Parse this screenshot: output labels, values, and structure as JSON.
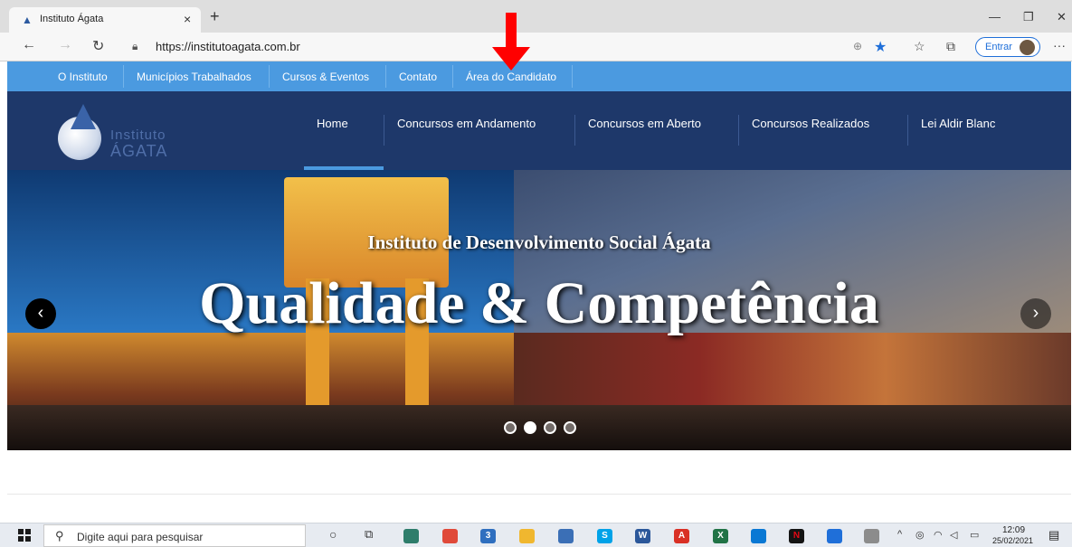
{
  "browser": {
    "tab_title": "Instituto Ágata",
    "tab_close": "×",
    "new_tab": "+",
    "url": "https://institutoagata.com.br",
    "entrar_label": "Entrar",
    "window_controls": [
      "—",
      "❐",
      "✕"
    ],
    "icons": [
      "back-icon",
      "forward-icon",
      "refresh-icon",
      "lock-icon",
      "zoom-icon",
      "favorite-star-icon",
      "favorites-list-icon",
      "collections-icon",
      "more-icon"
    ]
  },
  "site": {
    "top_nav": [
      "O Instituto",
      "Municípios Trabalhados",
      "Cursos & Eventos",
      "Contato",
      "Área do Candidato"
    ],
    "logo": {
      "line1": "Instituto",
      "line2": "ÁGATA"
    },
    "main_nav": [
      "Home",
      "Concursos em Andamento",
      "Concursos em Aberto",
      "Concursos Realizados",
      "Lei Aldir Blanc"
    ],
    "hero": {
      "subtitle": "Instituto de Desenvolvimento Social Ágata",
      "title": "Qualidade & Competência",
      "prev": "‹",
      "next": "›"
    }
  },
  "taskbar": {
    "search_placeholder": "Digite aqui para pesquisar",
    "time": "12:09",
    "date": "25/02/2021",
    "mail_badge": "3"
  },
  "colors": {
    "top_nav_bg": "#4b9ae0",
    "main_nav_bg": "#1e386a",
    "annotation_arrow": "#ff0000",
    "browser_accent": "#1f6fd9"
  }
}
